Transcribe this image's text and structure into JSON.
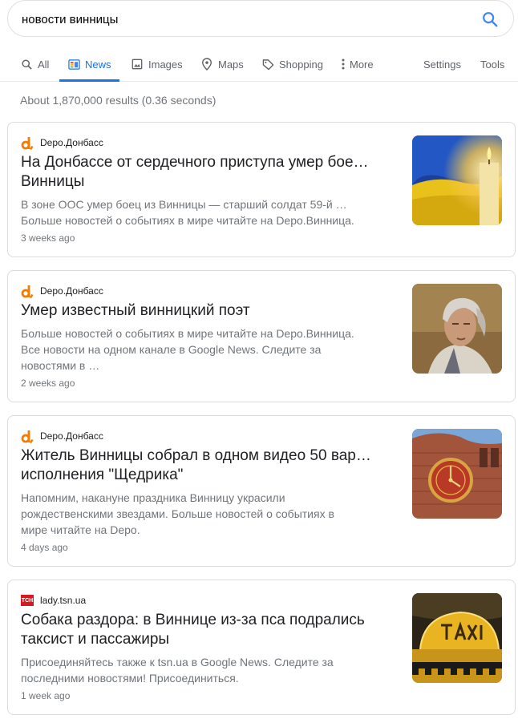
{
  "search": {
    "query": "новости винницы"
  },
  "tabs": [
    {
      "label": "All",
      "icon": "search-icon"
    },
    {
      "label": "News",
      "icon": "news-icon"
    },
    {
      "label": "Images",
      "icon": "image-icon"
    },
    {
      "label": "Maps",
      "icon": "map-pin-icon"
    },
    {
      "label": "Shopping",
      "icon": "tag-icon"
    },
    {
      "label": "More",
      "icon": "more-vert-icon"
    },
    {
      "label": "Settings"
    },
    {
      "label": "Tools"
    }
  ],
  "results_stats": "About 1,870,000 results (0.36 seconds)",
  "colors": {
    "accent": "#1a73e8",
    "depo": "#f57c00",
    "tsn": "#d71921"
  },
  "articles": [
    {
      "source": "Depo.Донбасс",
      "title_lines": [
        "На Донбассе от сердечного приступа умер бое…",
        "Винницы"
      ],
      "snippet_lines": [
        "В зоне ООС умер боец из Винницы — старший солдат 59-й …",
        "Больше новостей о событиях в мире читайте на Depo.Винница."
      ],
      "time": "3 weeks ago",
      "thumb": "flag-candle-image"
    },
    {
      "source": "Depo.Донбасс",
      "title_lines": [
        "Умер известный винницкий поэт"
      ],
      "snippet_lines": [
        "Больше новостей о событиях в мире читайте на Depo.Винница.",
        "Все новости на одном канале в Google News. Следите за",
        "новостями в …"
      ],
      "time": "2 weeks ago",
      "thumb": "poet-portrait-image"
    },
    {
      "source": "Depo.Донбасс",
      "title_lines": [
        "Житель Винницы собрал в одном видео 50 вар…",
        "исполнения \"Щедрика\""
      ],
      "snippet_lines": [
        "Напомним, накануне праздника Винницу украсили",
        "рождественскими звездами. Больше новостей о событиях в",
        "мире читайте на Depo."
      ],
      "time": "4 days ago",
      "thumb": "clock-tower-image"
    },
    {
      "source": "lady.tsn.ua",
      "title_lines": [
        "Собака раздора: в Виннице из-за пса подрались",
        "таксист и пассажиры"
      ],
      "snippet_lines": [
        "Присоединяйтесь также к tsn.ua в Google News. Следите за",
        "последними новостями! Присоединиться."
      ],
      "time": "1 week ago",
      "thumb": "taxi-sign-image",
      "logo_text": "ТСН"
    }
  ]
}
